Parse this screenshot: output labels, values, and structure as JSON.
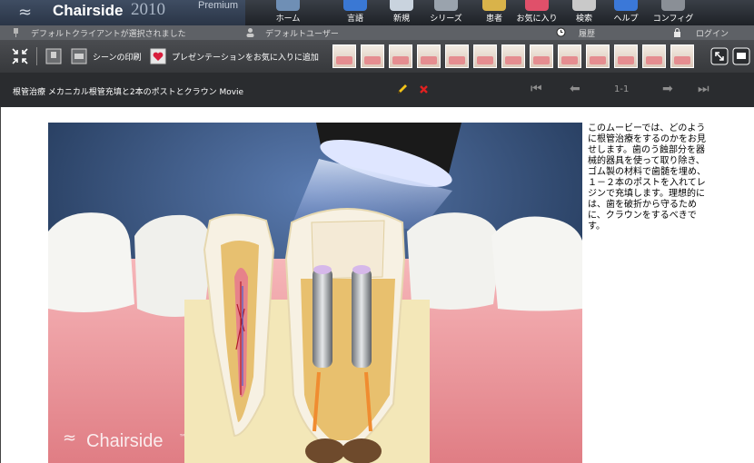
{
  "app": {
    "name": "Chairside",
    "year": "2010",
    "edition": "Premium"
  },
  "nav": [
    {
      "label": "ホーム",
      "icon": "home-icon",
      "color": "#6f8fb5"
    },
    {
      "label": "言語",
      "icon": "language-icon",
      "color": "#3a78d4"
    },
    {
      "label": "新規",
      "icon": "new-icon",
      "color": "#c9d3de"
    },
    {
      "label": "シリーズ",
      "icon": "series-icon",
      "color": "#9aa3ad"
    },
    {
      "label": "患者",
      "icon": "patient-icon",
      "color": "#d9b34a"
    },
    {
      "label": "お気に入り",
      "icon": "favorites-icon",
      "color": "#e0506a"
    },
    {
      "label": "検索",
      "icon": "search-icon",
      "color": "#c9c9c9"
    },
    {
      "label": "ヘルプ",
      "icon": "help-icon",
      "color": "#3b78d8"
    },
    {
      "label": "コンフィグ",
      "icon": "config-icon",
      "color": "#8a8f96"
    }
  ],
  "status": {
    "client": "デフォルトクライアントが選択されました",
    "user": "デフォルトユーザー",
    "history": "履歴",
    "login": "ログイン"
  },
  "toolbar": {
    "print_label": "シーンの印刷",
    "favorite_label": "プレゼンテーションをお気に入りに追加",
    "thumbnail_count": 13
  },
  "title_bar": {
    "title": "根管治療  メカニカル根管充填と2本のポストとクラウン  Movie",
    "page": "1-1"
  },
  "movie": {
    "watermark": "Chairside"
  },
  "description": "このムービーでは、どのように根管治療をするのかをお見せします。歯のう蝕部分を器械的器具を使って取り除き、ゴム製の材料で歯髄を埋め、１－２本のポストを入れてレジンで充填します。理想的には、歯を破折から守るために、クラウンをするべきです。",
  "colors": {
    "accent_red": "#e02020",
    "pencil_yellow": "#f2c318",
    "header_dark": "#2a2c2f"
  }
}
